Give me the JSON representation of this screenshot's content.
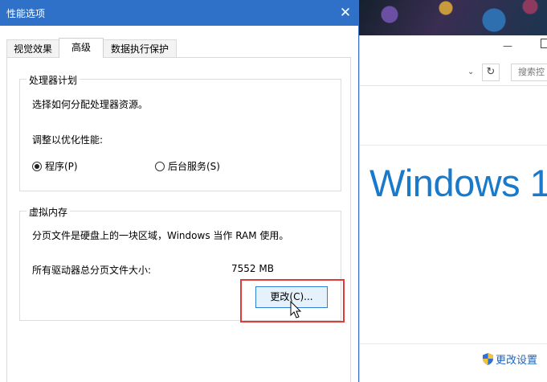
{
  "background_window": {
    "minimize": "—",
    "search_placeholder": "搜索控",
    "refresh_symbol": "↻",
    "dropdown_symbol": "⌄",
    "logo_text": "Windows 1",
    "change_settings": "更改设置"
  },
  "dialog": {
    "title": "性能选项",
    "close_symbol": "✕",
    "tabs": [
      {
        "label": "视觉效果",
        "active": false
      },
      {
        "label": "高级",
        "active": true
      },
      {
        "label": "数据执行保护",
        "active": false
      }
    ],
    "processor": {
      "legend": "处理器计划",
      "description": "选择如何分配处理器资源。",
      "adjust_label": "调整以优化性能:",
      "options": [
        {
          "label": "程序(P)",
          "selected": true
        },
        {
          "label": "后台服务(S)",
          "selected": false
        }
      ]
    },
    "virtual_memory": {
      "legend": "虚拟内存",
      "description": "分页文件是硬盘上的一块区域，Windows 当作 RAM 使用。",
      "total_label": "所有驱动器总分页文件大小:",
      "total_value": "7552 MB",
      "change_button": "更改(C)..."
    }
  },
  "colors": {
    "titlebar": "#2f71c8",
    "highlight": "#e03b3b",
    "logo": "#1979ca",
    "link": "#1a66c2"
  }
}
